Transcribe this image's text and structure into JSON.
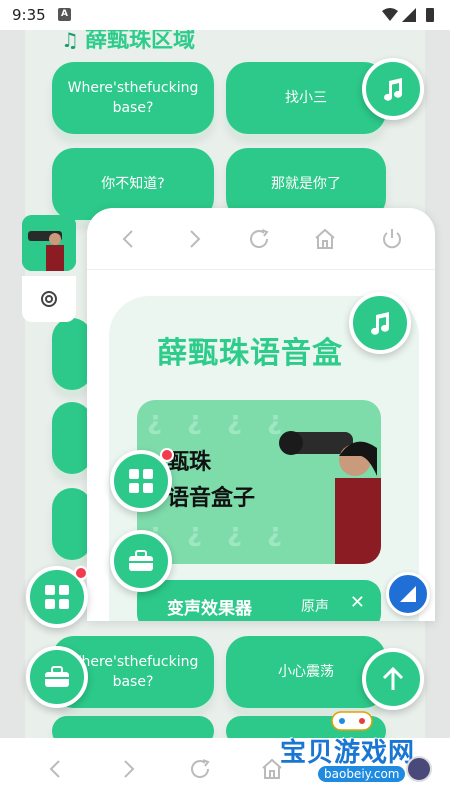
{
  "status_bar": {
    "time": "9:35"
  },
  "section": {
    "title": "薛甄珠区域"
  },
  "sound_buttons": [
    "Where'sthefucking base?",
    "找小三",
    "你不知道?",
    "那就是你了",
    "Where'sthefucking base?",
    "小心震荡"
  ],
  "panel": {
    "title": "薛甄珠语音盒",
    "banner_line1": "甄珠",
    "banner_line2": "语音盒子",
    "effects_label": "变声效果器",
    "effects_value": "原声",
    "effects_close": "✕"
  },
  "watermark": {
    "brand": "宝贝游戏网",
    "domain": "baobeiy.com"
  },
  "colors": {
    "primary": "#2cc98a",
    "title": "#2ecc8b",
    "badge": "#f23b4c",
    "float_blue": "#1f6fd6"
  }
}
